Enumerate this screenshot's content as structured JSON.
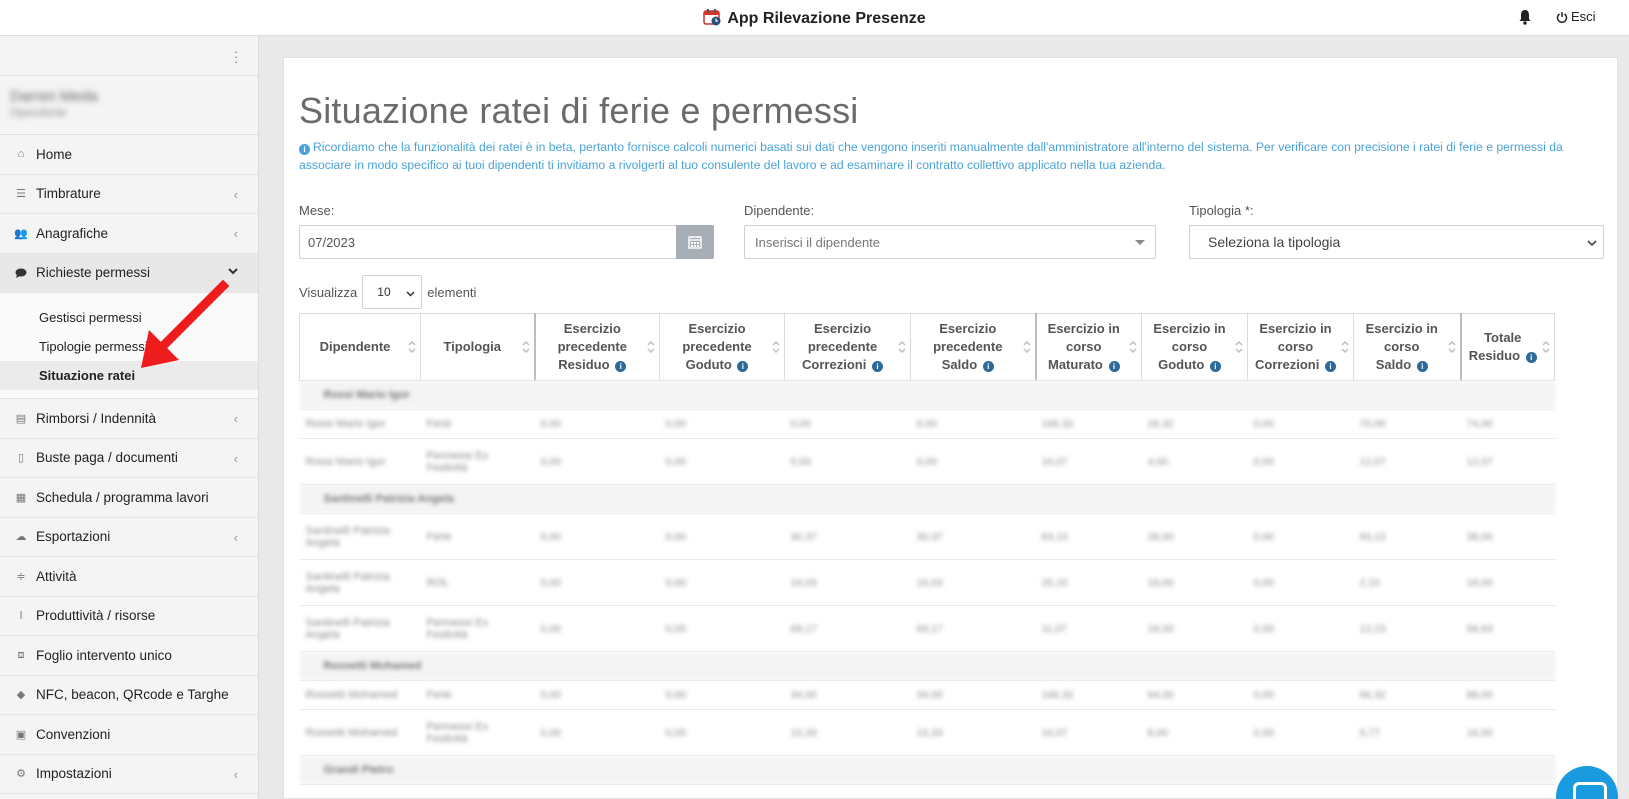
{
  "app": {
    "title": "App Rilevazione Presenze",
    "logout": "Esci"
  },
  "user": {
    "name": "Darren Meda",
    "role": "Dipendente"
  },
  "sidebar": {
    "items": [
      {
        "label": "Home",
        "icon": "home-icon"
      },
      {
        "label": "Timbrature",
        "icon": "list-icon"
      },
      {
        "label": "Anagrafiche",
        "icon": "users-icon"
      },
      {
        "label": "Richieste permessi",
        "icon": "comment-icon"
      },
      {
        "label": "Rimborsi / Indennità",
        "icon": "book-icon"
      },
      {
        "label": "Buste paga / documenti",
        "icon": "file-icon"
      },
      {
        "label": "Schedula / programma lavori",
        "icon": "briefcase-icon"
      },
      {
        "label": "Esportazioni",
        "icon": "cloud-download-icon"
      },
      {
        "label": "Attività",
        "icon": "sliders-icon"
      },
      {
        "label": "Produttività / risorse",
        "icon": "thermometer-icon"
      },
      {
        "label": "Foglio intervento unico",
        "icon": "barcode-icon"
      },
      {
        "label": "NFC, beacon, QRcode e Targhe",
        "icon": "tag-icon"
      },
      {
        "label": "Convenzioni",
        "icon": "gift-icon"
      },
      {
        "label": "Impostazioni",
        "icon": "gears-icon"
      }
    ],
    "submenu": [
      "Gestisci permessi",
      "Tipologie permessi",
      "Situazione ratei"
    ]
  },
  "page": {
    "title": "Situazione ratei di ferie e permessi",
    "info": "Ricordiamo che la funzionalità dei ratei è in beta, pertanto fornisce calcoli numerici basati sui dati che vengono inseriti manualmente dall'amministratore all'interno del sistema. Per verificare con precisione i ratei di ferie e permessi da associare in modo specifico ai tuoi dipendenti ti invitiamo a rivolgerti al tuo consulente del lavoro e ad esaminare il contratto collettivo applicato nella tua azienda."
  },
  "filters": {
    "mese_label": "Mese:",
    "mese_value": "07/2023",
    "dipendente_label": "Dipendente:",
    "dipendente_placeholder": "Inserisci il dipendente",
    "tipologia_label": "Tipologia *:",
    "tipologia_value": "Seleziona la tipologia"
  },
  "length": {
    "prefix": "Visualizza",
    "value": "10",
    "suffix": "elementi"
  },
  "table": {
    "headers": [
      {
        "l1": "Dipendente",
        "l2": "",
        "l3": "",
        "info": false
      },
      {
        "l1": "Tipologia",
        "l2": "",
        "l3": "",
        "info": false
      },
      {
        "l1": "Esercizio",
        "l2": "precedente",
        "l3": "Residuo",
        "info": true
      },
      {
        "l1": "Esercizio",
        "l2": "precedente",
        "l3": "Goduto",
        "info": true
      },
      {
        "l1": "Esercizio",
        "l2": "precedente",
        "l3": "Correzioni",
        "info": true
      },
      {
        "l1": "Esercizio",
        "l2": "precedente",
        "l3": "Saldo",
        "info": true
      },
      {
        "l1": "Esercizio in",
        "l2": "corso",
        "l3": "Maturato",
        "info": true
      },
      {
        "l1": "Esercizio in",
        "l2": "corso",
        "l3": "Goduto",
        "info": true
      },
      {
        "l1": "Esercizio in",
        "l2": "corso",
        "l3": "Correzioni",
        "info": true
      },
      {
        "l1": "Esercizio in",
        "l2": "corso",
        "l3": "Saldo",
        "info": true
      },
      {
        "l1": "Totale",
        "l2": "Residuo",
        "l3": "",
        "info": true
      }
    ],
    "groups": [
      {
        "name": "Rossi Mario Igor",
        "rows": [
          {
            "tall": false,
            "cells": [
              "Rossi Mario Igor",
              "Ferie",
              "0,00",
              "0,00",
              "0,00",
              "0,00",
              "166,32",
              "26,32",
              "0,00",
              "70,00",
              "74,00"
            ]
          },
          {
            "tall": true,
            "cells": [
              "Rossi Mario Igor",
              "Permessi Ex Festività",
              "0,00",
              "0,00",
              "0,00",
              "0,00",
              "16,07",
              "4,00",
              "0,00",
              "12,07",
              "12,07"
            ]
          }
        ]
      },
      {
        "name": "Santinelli Patrizia Angela",
        "rows": [
          {
            "tall": true,
            "cells": [
              "Santinelli Patrizia Angela",
              "Ferie",
              "0,00",
              "0,00",
              "30,37",
              "30,37",
              "63,13",
              "28,00",
              "0,00",
              "93,13",
              "38,00"
            ]
          },
          {
            "tall": true,
            "cells": [
              "Santinelli Patrizia Angela",
              "ROL",
              "0,00",
              "0,00",
              "16,03",
              "16,03",
              "25,15",
              "18,00",
              "0,00",
              "2,15",
              "18,00"
            ]
          },
          {
            "tall": true,
            "cells": [
              "Santinelli Patrizia Angela",
              "Permessi Ex Festività",
              "0,00",
              "0,00",
              "69,17",
              "69,17",
              "11,07",
              "18,00",
              "0,00",
              "12,23",
              "58,83"
            ]
          }
        ]
      },
      {
        "name": "Rossetti Mohamed",
        "rows": [
          {
            "tall": false,
            "cells": [
              "Rossetti Mohamed",
              "Ferie",
              "0,00",
              "0,00",
              "34,00",
              "34,00",
              "166,32",
              "64,00",
              "0,00",
              "66,32",
              "88,00"
            ]
          },
          {
            "tall": true,
            "cells": [
              "Rossetti Mohamed",
              "Permessi Ex Festività",
              "0,00",
              "0,00",
              "15,33",
              "15,33",
              "16,07",
              "8,00",
              "0,00",
              "5,77",
              "16,00"
            ]
          }
        ]
      },
      {
        "name": "Grandi Pietro",
        "rows": []
      }
    ]
  }
}
